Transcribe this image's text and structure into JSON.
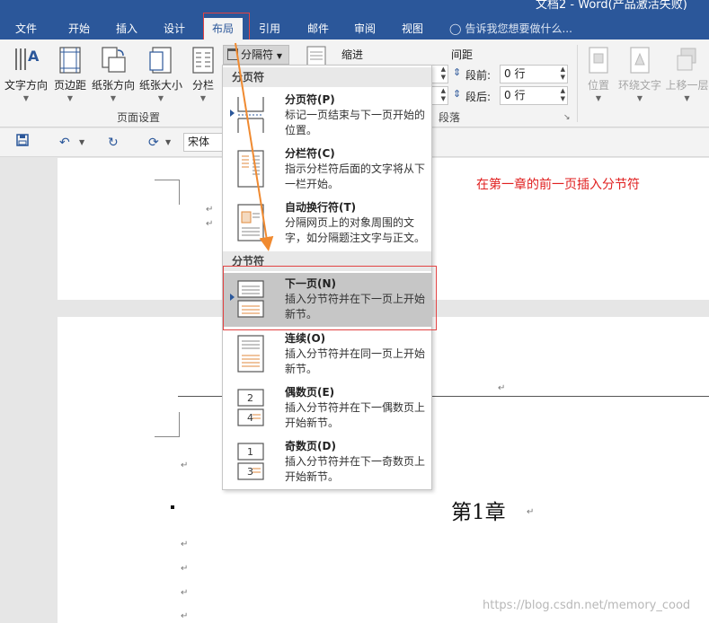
{
  "app": {
    "title": "文档2 - Word(产品激活失败)"
  },
  "tabs": [
    "文件",
    "开始",
    "插入",
    "设计",
    "布局",
    "引用",
    "邮件",
    "审阅",
    "视图"
  ],
  "active_tab": "布局",
  "tellme": "告诉我您想要做什么...",
  "ribbon": {
    "page_setup_buttons": [
      "文字方向",
      "页边距",
      "纸张方向",
      "纸张大小",
      "分栏"
    ],
    "page_setup_label": "页面设置",
    "breaks_button": "分隔符",
    "indent_label": "缩进",
    "spacing_label": "间距",
    "spacing_before_label": "段前:",
    "spacing_before_value": "0 行",
    "spacing_after_label": "段后:",
    "spacing_after_value": "0 行",
    "paragraph_label": "段落",
    "arrange_buttons": [
      "位置",
      "环绕文字",
      "上移一层"
    ]
  },
  "qat": {
    "font": "宋体"
  },
  "menu": {
    "page_breaks_header": "分页符",
    "section_breaks_header": "分节符",
    "page_breaks": [
      {
        "title": "分页符(P)",
        "desc": "标记一页结束与下一页开始的位置。"
      },
      {
        "title": "分栏符(C)",
        "desc": "指示分栏符后面的文字将从下一栏开始。"
      },
      {
        "title": "自动换行符(T)",
        "desc": "分隔网页上的对象周围的文字，如分隔题注文字与正文。"
      }
    ],
    "section_breaks": [
      {
        "title": "下一页(N)",
        "desc": "插入分节符并在下一页上开始新节。"
      },
      {
        "title": "连续(O)",
        "desc": "插入分节符并在同一页上开始新节。"
      },
      {
        "title": "偶数页(E)",
        "desc": "插入分节符并在下一偶数页上开始新节。"
      },
      {
        "title": "奇数页(D)",
        "desc": "插入分节符并在下一奇数页上开始新节。"
      }
    ]
  },
  "document": {
    "annotation": "在第一章的前一页插入分节符",
    "chapter_heading": "第1章",
    "paragraph_mark": "↵",
    "watermark": "https://blog.csdn.net/memory_cood"
  },
  "colors": {
    "word_blue": "#2b579a",
    "highlight_red": "#e24343",
    "annotation_red": "#e02020",
    "arrow_orange": "#f08a30"
  }
}
